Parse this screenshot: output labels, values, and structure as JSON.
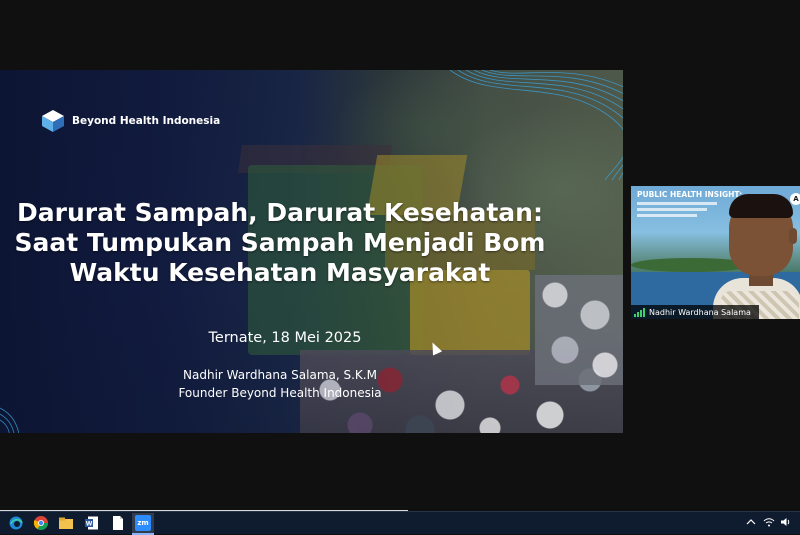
{
  "slide": {
    "brand_name": "Beyond Health Indonesia",
    "title_lines": [
      "Darurat Sampah, Darurat Kesehatan:",
      "Saat Tumpukan Sampah Menjadi Bom",
      "Waktu Kesehatan Masyarakat"
    ],
    "place_date": "Ternate, 18 Mei 2025",
    "author_name": "Nadhir Wardhana Salama, S.K.M",
    "author_role": "Founder Beyond Health Indonesia"
  },
  "video_tile": {
    "participant_name": "Nadhir Wardhana Salama",
    "virtual_background_title": "PUBLIC HEALTH INSIGHT:",
    "badge": "A",
    "audio_status": "signal-bars-icon"
  },
  "taskbar": {
    "apps": [
      "edge-icon",
      "chrome-icon",
      "file-explorer-icon",
      "word-icon",
      "document-icon",
      "zoom-icon"
    ],
    "active_app": "zoom-icon",
    "zoom_label": "zm",
    "tray": [
      "chevron-up-icon",
      "wifi-icon",
      "volume-icon"
    ]
  },
  "colors": {
    "slide_bg": "#0d1535",
    "taskbar_bg": "#0f1b2e",
    "accent_wave": "#3aa0d8",
    "name_bar": "#000000"
  }
}
